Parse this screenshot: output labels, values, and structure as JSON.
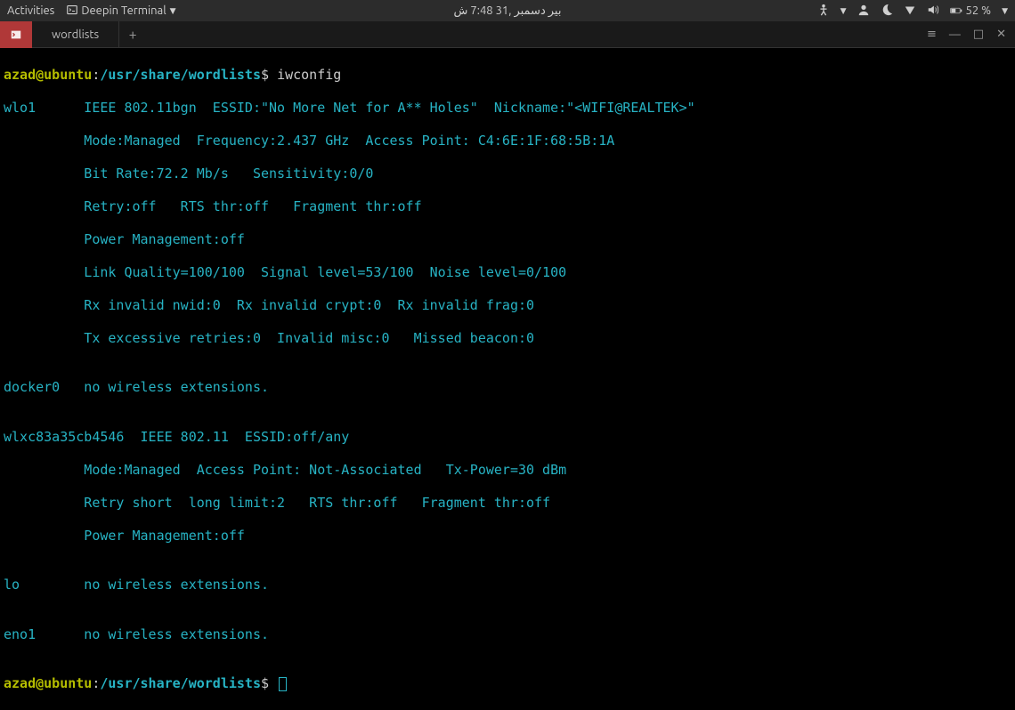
{
  "topbar": {
    "activities": "Activities",
    "app_name": "Deepin Terminal",
    "clock": "بیر دسمبر ,31 7:48 ش",
    "battery": "52 %"
  },
  "tabbar": {
    "tab1": "wordlists",
    "add": "+",
    "menu": "≡",
    "minimize": "—",
    "maximize": "□",
    "close": "✕"
  },
  "prompt": {
    "user": "azad",
    "at": "@",
    "host": "ubuntu",
    "colon": ":",
    "path": "/usr/share/wordlists",
    "dollar": "$ "
  },
  "cmd1": "iwconfig",
  "out": {
    "l1": "wlo1      IEEE 802.11bgn  ESSID:\"No More Net for A** Holes\"  Nickname:\"<WIFI@REALTEK>\"",
    "l2": "          Mode:Managed  Frequency:2.437 GHz  Access Point: C4:6E:1F:68:5B:1A",
    "l3": "          Bit Rate:72.2 Mb/s   Sensitivity:0/0",
    "l4": "          Retry:off   RTS thr:off   Fragment thr:off",
    "l5": "          Power Management:off",
    "l6": "          Link Quality=100/100  Signal level=53/100  Noise level=0/100",
    "l7": "          Rx invalid nwid:0  Rx invalid crypt:0  Rx invalid frag:0",
    "l8": "          Tx excessive retries:0  Invalid misc:0   Missed beacon:0",
    "blank1": "",
    "l9": "docker0   no wireless extensions.",
    "blank2": "",
    "l10": "wlxc83a35cb4546  IEEE 802.11  ESSID:off/any",
    "l11": "          Mode:Managed  Access Point: Not-Associated   Tx-Power=30 dBm",
    "l12": "          Retry short  long limit:2   RTS thr:off   Fragment thr:off",
    "l13": "          Power Management:off",
    "blank3": "",
    "l14": "lo        no wireless extensions.",
    "blank4": "",
    "l15": "eno1      no wireless extensions.",
    "blank5": ""
  }
}
